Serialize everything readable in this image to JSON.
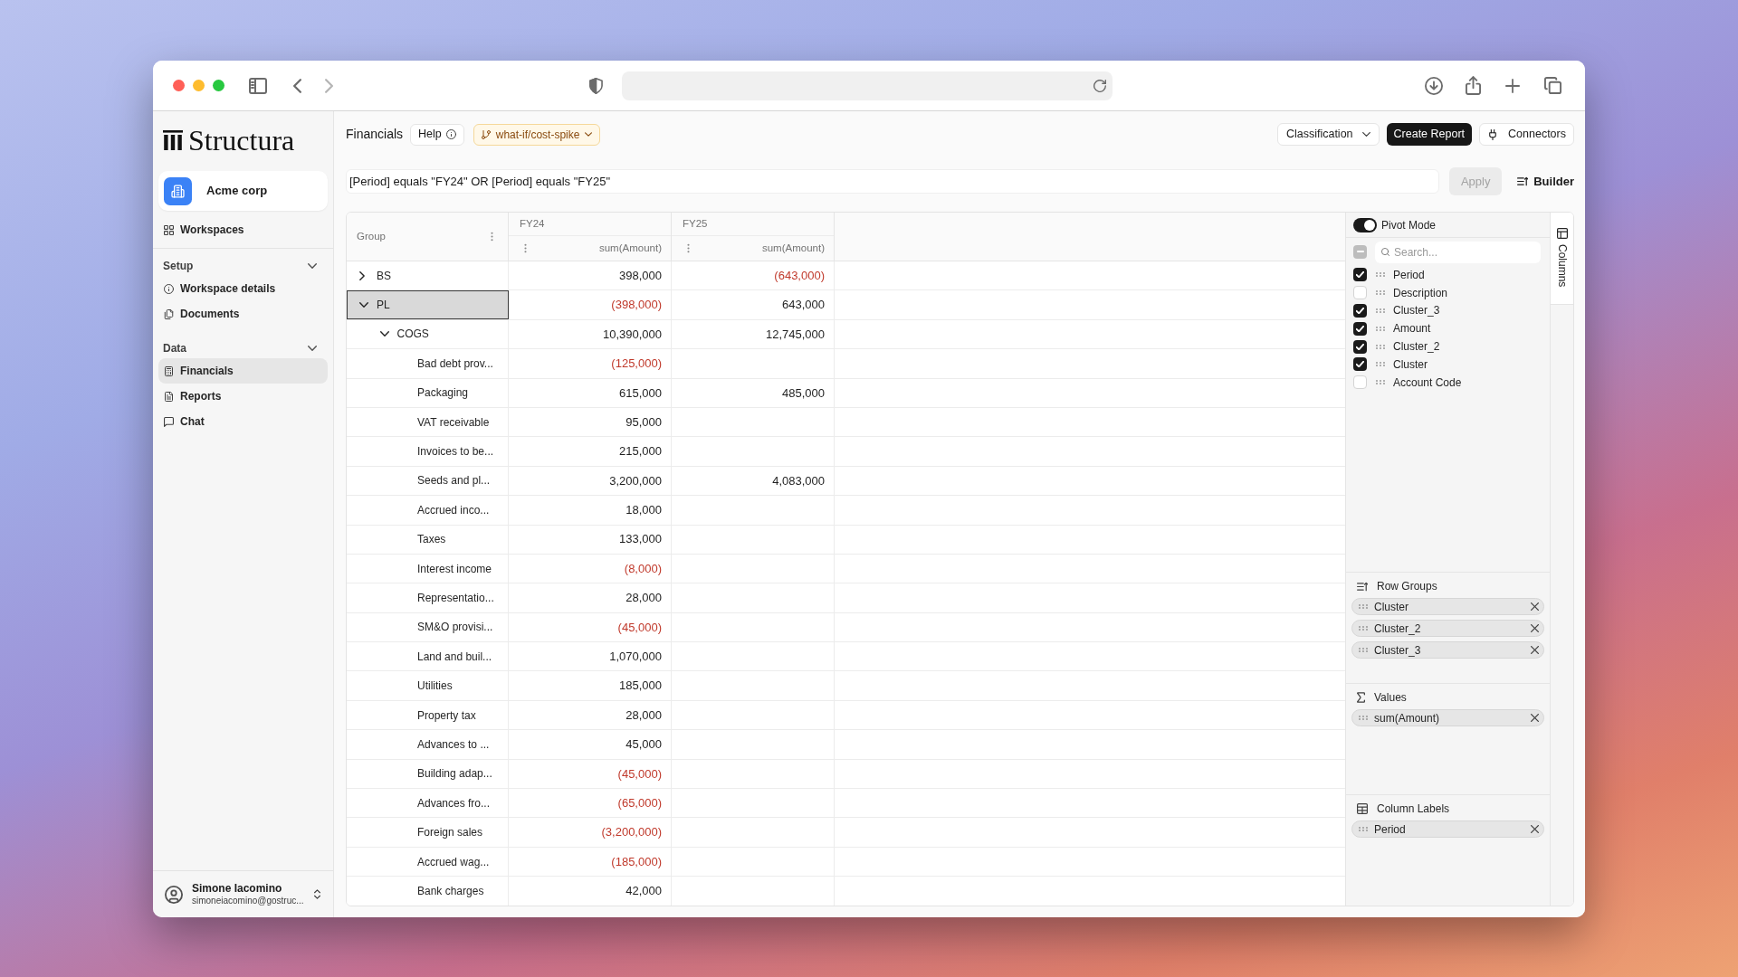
{
  "sidebar": {
    "brand": "Structura",
    "workspace": "Acme corp",
    "nav": [
      {
        "label": "Workspaces",
        "selected": false
      }
    ],
    "sections": [
      {
        "title": "Setup",
        "expanded": true,
        "items": [
          {
            "label": "Workspace details",
            "selected": false
          },
          {
            "label": "Documents",
            "selected": false
          }
        ]
      },
      {
        "title": "Data",
        "expanded": true,
        "items": [
          {
            "label": "Financials",
            "selected": true
          },
          {
            "label": "Reports",
            "selected": false
          },
          {
            "label": "Chat",
            "selected": false
          }
        ]
      }
    ],
    "user": {
      "name": "Simone Iacomino",
      "email": "simoneiacomino@gostruc..."
    }
  },
  "toolbar": {
    "title": "Financials",
    "help": "Help",
    "branch": "what-if/cost-spike",
    "classification": "Classification",
    "create_report": "Create Report",
    "connectors": "Connectors"
  },
  "filter": {
    "value": "[Period] equals \"FY24\" OR [Period] equals \"FY25\"",
    "apply": {
      "label": "Apply",
      "disabled": true
    },
    "builder": "Builder"
  },
  "grid": {
    "group_header": "Group",
    "column_groups": [
      {
        "label": "FY24",
        "value_header": "sum(Amount)"
      },
      {
        "label": "FY25",
        "value_header": "sum(Amount)"
      }
    ],
    "rows": [
      {
        "label": "BS",
        "expanded": false,
        "selected": false,
        "values": [
          {
            "text": "398,000",
            "negative": false
          },
          {
            "text": "(643,000)",
            "negative": true
          }
        ]
      },
      {
        "label": "PL",
        "expanded": true,
        "selected": true,
        "values": [
          {
            "text": "(398,000)",
            "negative": true
          },
          {
            "text": "643,000",
            "negative": false
          }
        ],
        "children": [
          {
            "label": "COGS",
            "expanded": true,
            "selected": false,
            "values": [
              {
                "text": "10,390,000",
                "negative": false
              },
              {
                "text": "12,745,000",
                "negative": false
              }
            ],
            "children": [
              {
                "label": "Bad debt prov...",
                "selected": false,
                "values": [
                  {
                    "text": "(125,000)",
                    "negative": true
                  }
                ]
              },
              {
                "label": "Packaging",
                "selected": false,
                "values": [
                  {
                    "text": "615,000",
                    "negative": false
                  },
                  {
                    "text": "485,000",
                    "negative": false
                  }
                ]
              },
              {
                "label": "VAT receivable",
                "selected": false,
                "values": [
                  {
                    "text": "95,000",
                    "negative": false
                  }
                ]
              },
              {
                "label": "Invoices to be...",
                "selected": false,
                "values": [
                  {
                    "text": "215,000",
                    "negative": false
                  }
                ]
              },
              {
                "label": "Seeds and pl...",
                "selected": false,
                "values": [
                  {
                    "text": "3,200,000",
                    "negative": false
                  },
                  {
                    "text": "4,083,000",
                    "negative": false
                  }
                ]
              },
              {
                "label": "Accrued inco...",
                "selected": false,
                "values": [
                  {
                    "text": "18,000",
                    "negative": false
                  }
                ]
              },
              {
                "label": "Taxes",
                "selected": false,
                "values": [
                  {
                    "text": "133,000",
                    "negative": false
                  }
                ]
              },
              {
                "label": "Interest income",
                "selected": false,
                "values": [
                  {
                    "text": "(8,000)",
                    "negative": true
                  }
                ]
              },
              {
                "label": "Representatio...",
                "selected": false,
                "values": [
                  {
                    "text": "28,000",
                    "negative": false
                  }
                ]
              },
              {
                "label": "SM&O provisi...",
                "selected": false,
                "values": [
                  {
                    "text": "(45,000)",
                    "negative": true
                  }
                ]
              },
              {
                "label": "Land and buil...",
                "selected": false,
                "values": [
                  {
                    "text": "1,070,000",
                    "negative": false
                  }
                ]
              },
              {
                "label": "Utilities",
                "selected": false,
                "values": [
                  {
                    "text": "185,000",
                    "negative": false
                  }
                ]
              },
              {
                "label": "Property tax",
                "selected": false,
                "values": [
                  {
                    "text": "28,000",
                    "negative": false
                  }
                ]
              },
              {
                "label": "Advances to ...",
                "selected": false,
                "values": [
                  {
                    "text": "45,000",
                    "negative": false
                  }
                ]
              },
              {
                "label": "Building adap...",
                "selected": false,
                "values": [
                  {
                    "text": "(45,000)",
                    "negative": true
                  }
                ]
              },
              {
                "label": "Advances fro...",
                "selected": false,
                "values": [
                  {
                    "text": "(65,000)",
                    "negative": true
                  }
                ]
              },
              {
                "label": "Foreign sales",
                "selected": false,
                "values": [
                  {
                    "text": "(3,200,000)",
                    "negative": true
                  }
                ]
              },
              {
                "label": "Accrued wag...",
                "selected": false,
                "values": [
                  {
                    "text": "(185,000)",
                    "negative": true
                  }
                ]
              },
              {
                "label": "Bank charges",
                "selected": false,
                "values": [
                  {
                    "text": "42,000",
                    "negative": false
                  }
                ]
              }
            ]
          }
        ]
      }
    ]
  },
  "pivot_panel": {
    "pivot_mode": {
      "label": "Pivot Mode",
      "on": true
    },
    "select_all": {
      "indeterminate": true
    },
    "search": {
      "placeholder": "Search..."
    },
    "columns": [
      {
        "label": "Period",
        "checked": true
      },
      {
        "label": "Description",
        "checked": false
      },
      {
        "label": "Cluster_3",
        "checked": true
      },
      {
        "label": "Amount",
        "checked": true
      },
      {
        "label": "Cluster_2",
        "checked": true
      },
      {
        "label": "Cluster",
        "checked": true
      },
      {
        "label": "Account Code",
        "checked": false
      }
    ],
    "drop_zones": [
      {
        "title": "Row Groups",
        "items": [
          "Cluster",
          "Cluster_2",
          "Cluster_3"
        ]
      },
      {
        "title": "Values",
        "items": [
          "sum(Amount)"
        ]
      },
      {
        "title": "Column Labels",
        "items": [
          "Period"
        ]
      }
    ],
    "side_tabs": [
      {
        "label": "Columns",
        "selected": true
      }
    ]
  }
}
